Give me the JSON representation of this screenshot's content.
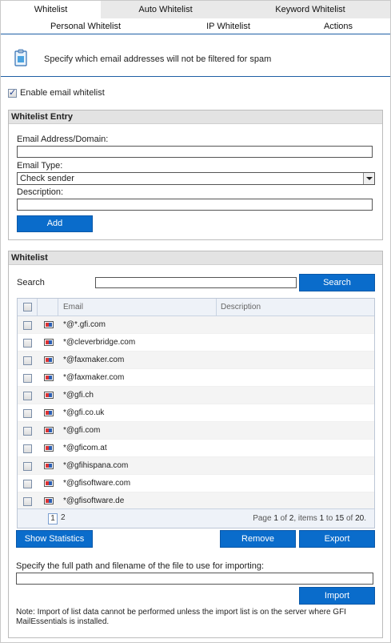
{
  "tabs_row1": [
    "Whitelist",
    "Auto Whitelist",
    "Keyword Whitelist"
  ],
  "tabs_row2": [
    "Personal Whitelist",
    "IP Whitelist",
    "Actions"
  ],
  "header": {
    "description": "Specify which email addresses will not be filtered for spam"
  },
  "enable_label": "Enable email whitelist",
  "entry": {
    "title": "Whitelist Entry",
    "email_label": "Email Address/Domain:",
    "type_label": "Email Type:",
    "type_value": "Check sender",
    "description_label": "Description:",
    "add_button": "Add"
  },
  "whitelist": {
    "title": "Whitelist",
    "search_label": "Search",
    "search_button": "Search",
    "columns": {
      "email": "Email",
      "description": "Description"
    },
    "rows": [
      "*@*.gfi.com",
      "*@cleverbridge.com",
      "*@faxmaker.com",
      "*@faxmaker.com",
      "*@gfi.ch",
      "*@gfi.co.uk",
      "*@gfi.com",
      "*@gficom.at",
      "*@gfihispana.com",
      "*@gfisoftware.com",
      "*@gfisoftware.de"
    ],
    "pager": {
      "pages": [
        "1",
        "2"
      ],
      "page_prefix": "Page ",
      "page_current": "1",
      "page_of": " of ",
      "page_total": "2",
      "items_prefix": ", items ",
      "items_from": "1",
      "items_to_word": " to ",
      "items_to": "15",
      "items_of": " of ",
      "items_total": "20",
      "suffix": "."
    },
    "show_stats_button": "Show Statistics",
    "remove_button": "Remove",
    "export_button": "Export",
    "import_label": "Specify the full path and filename of the file to use for importing:",
    "import_button": "Import",
    "note": "Note: Import of list data cannot be performed unless the import list is on the server where GFI MailEssentials is installed."
  },
  "colors": {
    "accent": "#0a6ccb",
    "rule": "#1f5fa5"
  }
}
